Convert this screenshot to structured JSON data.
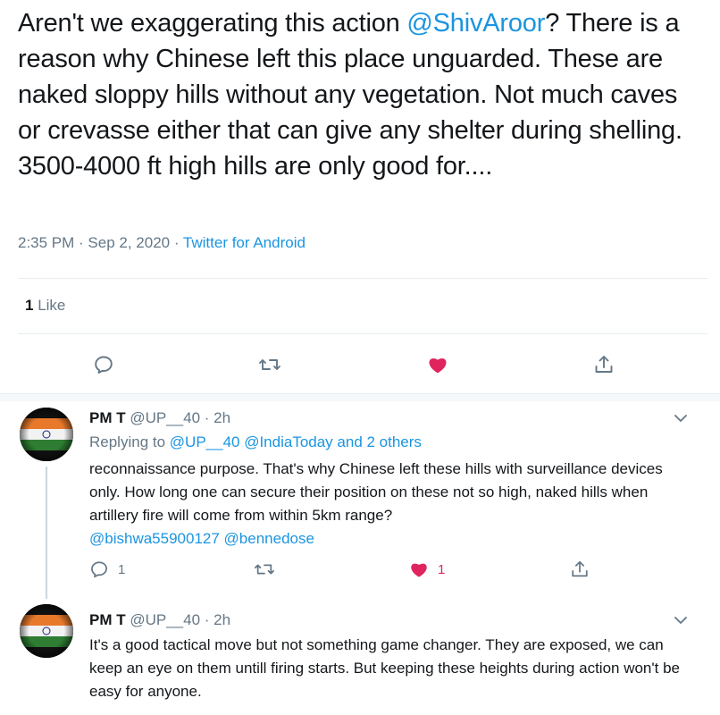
{
  "tweet": {
    "text_before": "Aren't we exaggerating this action ",
    "mention": "@ShivAroor",
    "text_after": "? There is a reason why Chinese left this place unguarded. These are naked sloppy hills without any vegetation. Not much caves or crevasse either that can give any shelter during shelling. 3500-4000 ft high hills are only good for....",
    "time": "2:35 PM · Sep 2, 2020 · ",
    "source": "Twitter for Android",
    "likes_count": "1",
    "likes_label": " Like",
    "liked": true,
    "icons": [
      "reply-icon",
      "retweet-icon",
      "like-icon",
      "share-icon"
    ],
    "colors": {
      "like": "#e0245e",
      "link": "#1b95e0",
      "muted": "#657786"
    }
  },
  "replies": [
    {
      "name": "PM T",
      "handle_time": " @UP__40 · 2h",
      "replying_prefix": "Replying to ",
      "replying_links": "@UP__40 @IndiaToday and 2 others",
      "text": "reconnaissance purpose. That's why Chinese left these hills with surveillance devices only. How long one can secure their position on these not so high, naked hills when artillery fire will come from within 5km range?",
      "mentions": "@bishwa55900127 @bennedose",
      "reply_count": "1",
      "like_count": "1"
    },
    {
      "name": "PM T",
      "handle_time": " @UP__40 · 2h",
      "text": "It's a good tactical move but not something game changer. They are exposed, we can keep an eye on them untill firing starts. But keeping these heights during action won't be easy for anyone."
    }
  ]
}
